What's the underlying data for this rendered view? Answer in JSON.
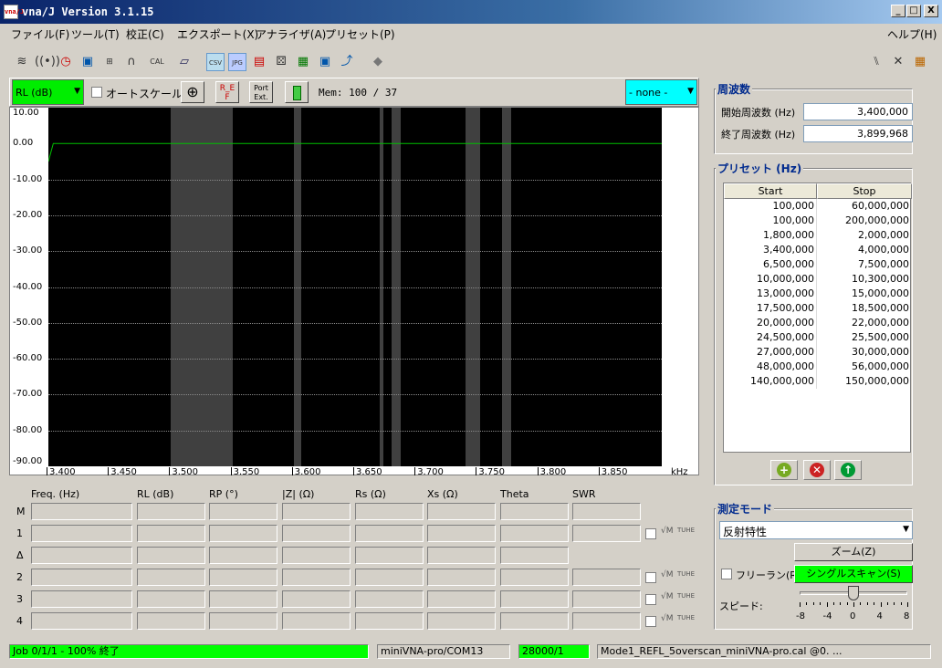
{
  "window": {
    "title": "vna/J Version 3.1.15",
    "icon_text": "vna/J",
    "minimize": "_",
    "maximize": "□",
    "close": "X"
  },
  "menu": [
    "ファイル(F)",
    "ツール(T)",
    "校正(C)",
    "エクスポート(X)",
    "アナライザ(A)",
    "プリセット(P)"
  ],
  "menu_help": "ヘルプ(H)",
  "toolbar_icons": [
    "scan-icon",
    "wireless-icon",
    "clock-icon",
    "save-icon",
    "calibration-icon",
    "analyzer-icon",
    "cal-icon",
    "open-folder-icon",
    "csv-icon",
    "jpg-icon",
    "pdf-icon",
    "dice-icon",
    "excel-icon",
    "xml-icon",
    "graph-icon",
    "eraser-icon"
  ],
  "toolbar_cal_label": "CAL",
  "toolbar_csv_label": "CSV",
  "toolbar_jpg_label": "JPG",
  "chart_controls": {
    "trace_select": "RL (dB)",
    "autoscale_label": "オートスケール",
    "port_ext_label": "Port Ext.",
    "ref_label": "R_E F",
    "mem_label": "Mem: 100 / 37",
    "compare_select": "- none -"
  },
  "chart_data": {
    "type": "line",
    "series": [
      {
        "values": [
          -5,
          0.0,
          0.0,
          0.0,
          0.0,
          0.0,
          0.0,
          0.0,
          0.0,
          0.0,
          0.0,
          0.0
        ]
      }
    ],
    "x": [
      3.4,
      3.404,
      3.45,
      3.5,
      3.55,
      3.6,
      3.65,
      3.7,
      3.75,
      3.8,
      3.85,
      3.9
    ],
    "xticks": [
      "3.400",
      "3.450",
      "3.500",
      "3.550",
      "3.600",
      "3.650",
      "3.700",
      "3.750",
      "3.800",
      "3.850"
    ],
    "xunit": "kHz",
    "yticks": [
      "10.00",
      "0.00",
      "-10.00",
      "-20.00",
      "-30.00",
      "-40.00",
      "-50.00",
      "-60.00",
      "-70.00",
      "-80.00",
      "-90.00"
    ],
    "ylim": [
      -90,
      10
    ],
    "xlim": [
      3.4,
      3.9
    ],
    "grid": true,
    "shaded_bands": [
      [
        3.5,
        3.55
      ],
      [
        3.6,
        3.606
      ],
      [
        3.67,
        3.673
      ],
      [
        3.68,
        3.687
      ],
      [
        3.74,
        3.752
      ],
      [
        3.77,
        3.777
      ]
    ],
    "colors": {
      "background": "#000000",
      "trace": "#00c000",
      "band": "#404040"
    }
  },
  "readout": {
    "headers": [
      "Freq. (Hz)",
      "RL (dB)",
      "RP (°)",
      "|Z| (Ω)",
      "Rs (Ω)",
      "Xs (Ω)",
      "Theta",
      "SWR"
    ],
    "rows": [
      "M",
      "1",
      "Δ",
      "2",
      "3",
      "4"
    ]
  },
  "frequency": {
    "title": "周波数",
    "start_label": "開始周波数 (Hz)",
    "start_value": "3,400,000",
    "stop_label": "終了周波数 (Hz)",
    "stop_value": "3,899,968"
  },
  "presets": {
    "title": "プリセット (Hz)",
    "col_start": "Start",
    "col_stop": "Stop",
    "rows": [
      [
        "100,000",
        "60,000,000"
      ],
      [
        "100,000",
        "200,000,000"
      ],
      [
        "1,800,000",
        "2,000,000"
      ],
      [
        "3,400,000",
        "4,000,000"
      ],
      [
        "6,500,000",
        "7,500,000"
      ],
      [
        "10,000,000",
        "10,300,000"
      ],
      [
        "13,000,000",
        "15,000,000"
      ],
      [
        "17,500,000",
        "18,500,000"
      ],
      [
        "20,000,000",
        "22,000,000"
      ],
      [
        "24,500,000",
        "25,500,000"
      ],
      [
        "27,000,000",
        "30,000,000"
      ],
      [
        "48,000,000",
        "56,000,000"
      ],
      [
        "140,000,000",
        "150,000,000"
      ]
    ]
  },
  "mode": {
    "title": "測定モード",
    "select": "反射特性",
    "zoom_button": "ズーム(Z)",
    "freerun_label": "フリーラン(R)",
    "single_scan_button": "シングルスキャン(S)",
    "speed_label": "スピード:",
    "speed_ticks": [
      "-8",
      "-4",
      "0",
      "4",
      "8"
    ],
    "speed_value": 0
  },
  "status": {
    "job": "Job 0/1/1 - 100% 終了",
    "device": "miniVNA-pro/COM13",
    "samples": "28000/1",
    "calfile": "Mode1_REFL_5overscan_miniVNA-pro.cal @0. ..."
  }
}
